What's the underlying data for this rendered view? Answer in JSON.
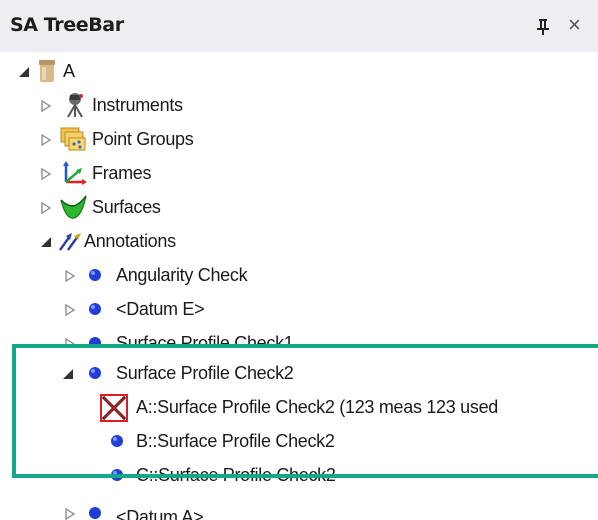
{
  "panel": {
    "title": "SA TreeBar",
    "pin_icon": "pin-icon",
    "close_glyph": "×"
  },
  "tree": {
    "root": {
      "label": "A",
      "icon": "collection-jar-icon",
      "expanded": true
    },
    "instruments": {
      "label": "Instruments",
      "icon": "instrument-tripod-icon"
    },
    "point_groups": {
      "label": "Point Groups",
      "icon": "point-groups-icon"
    },
    "frames": {
      "label": "Frames",
      "icon": "frames-axes-icon"
    },
    "surfaces": {
      "label": "Surfaces",
      "icon": "surfaces-icon"
    },
    "annotations": {
      "label": "Annotations",
      "icon": "annotations-icon",
      "expanded": true
    },
    "annotation_items": [
      {
        "label": "Angularity Check"
      },
      {
        "label": "<Datum  E>"
      },
      {
        "label": "Surface Profile Check1"
      },
      {
        "label": "Surface Profile Check2",
        "expanded": true
      },
      {
        "label": "<Datum  A>"
      }
    ],
    "check2_children": [
      {
        "label": "A::Surface Profile Check2 (123 meas 123 used",
        "icon": "failed-x-icon"
      },
      {
        "label": "B::Surface Profile Check2"
      },
      {
        "label": "C::Surface Profile Check2"
      }
    ]
  },
  "colors": {
    "highlight_border": "#14a88a",
    "dot_blue": "#1f3fd6",
    "fail_red": "#e01b24"
  }
}
